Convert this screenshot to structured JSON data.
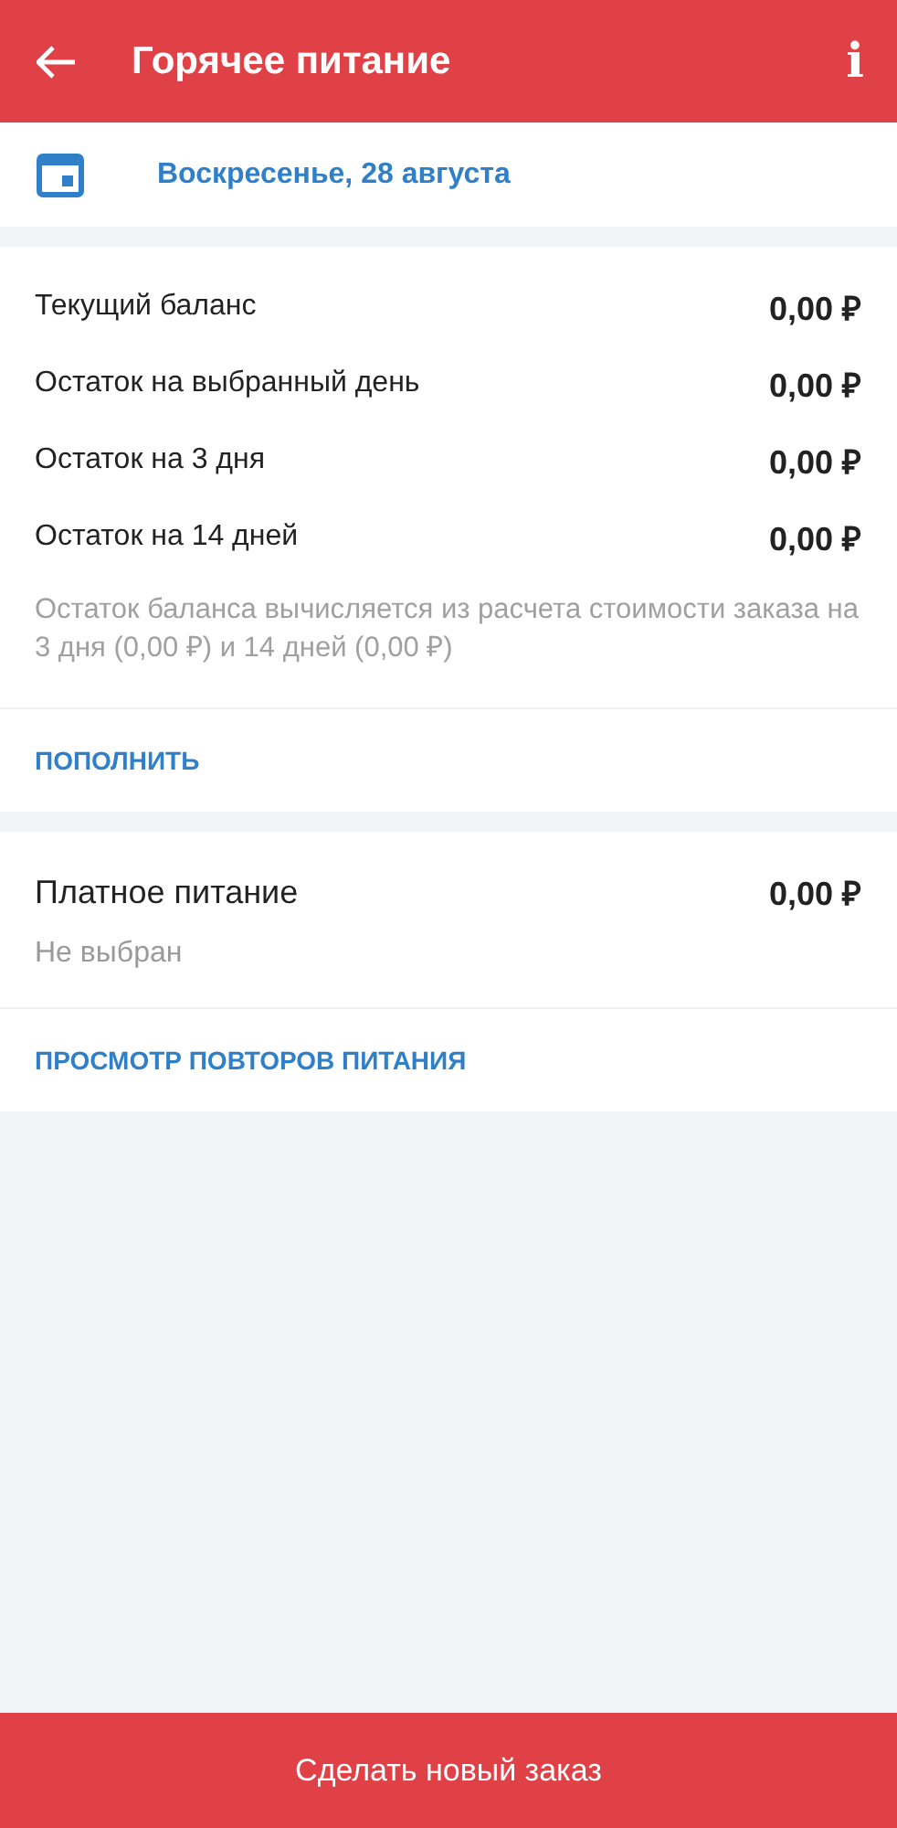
{
  "header": {
    "title": "Горячее питание",
    "info": "i"
  },
  "date": {
    "label": "Воскресенье, 28 августа"
  },
  "balance": {
    "rows": [
      {
        "label": "Текущий баланс",
        "value": "0,00 ₽"
      },
      {
        "label": "Остаток на выбранный день",
        "value": "0,00 ₽"
      },
      {
        "label": "Остаток на 3 дня",
        "value": "0,00 ₽"
      },
      {
        "label": "Остаток на 14 дней",
        "value": "0,00 ₽"
      }
    ],
    "note": "Остаток баланса вычисляется из расчета стоимости заказа на 3 дня (0,00 ₽) и 14 дней (0,00 ₽)",
    "action": "ПОПОЛНИТЬ"
  },
  "paid": {
    "title": "Платное питание",
    "value": "0,00 ₽",
    "status": "Не выбран",
    "action": "ПРОСМОТР ПОВТОРОВ ПИТАНИЯ"
  },
  "bottom_button": "Сделать новый заказ"
}
